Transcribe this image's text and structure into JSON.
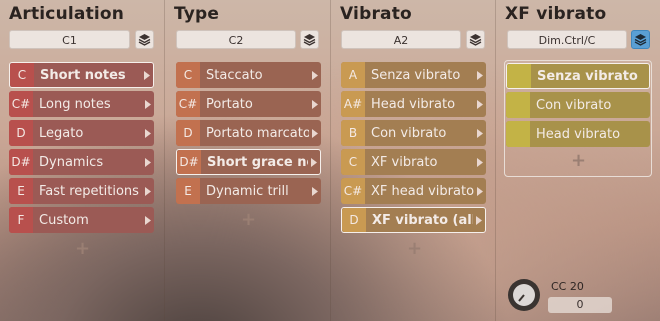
{
  "columns": [
    {
      "title": "Articulation",
      "field": "C1",
      "items": [
        {
          "key": "C",
          "label": "Short notes",
          "selected": true
        },
        {
          "key": "C#",
          "label": "Long notes"
        },
        {
          "key": "D",
          "label": "Legato"
        },
        {
          "key": "D#",
          "label": "Dynamics"
        },
        {
          "key": "E",
          "label": "Fast repetitions"
        },
        {
          "key": "F",
          "label": "Custom"
        }
      ],
      "add": "+"
    },
    {
      "title": "Type",
      "field": "C2",
      "items": [
        {
          "key": "C",
          "label": "Staccato"
        },
        {
          "key": "C#",
          "label": "Portato"
        },
        {
          "key": "D",
          "label": "Portato marcato"
        },
        {
          "key": "D#",
          "label": "Short grace note",
          "selected": true
        },
        {
          "key": "E",
          "label": "Dynamic trill"
        }
      ],
      "add": "+"
    },
    {
      "title": "Vibrato",
      "field": "A2",
      "items": [
        {
          "key": "A",
          "label": "Senza vibrato"
        },
        {
          "key": "A#",
          "label": "Head vibrato"
        },
        {
          "key": "B",
          "label": "Con vibrato"
        },
        {
          "key": "C",
          "label": "XF vibrato"
        },
        {
          "key": "C#",
          "label": "XF head vibrato"
        },
        {
          "key": "D",
          "label": "XF vibrato (all)",
          "selected": true
        }
      ],
      "add": "+"
    },
    {
      "title": "XF vibrato",
      "field": "Dim.Ctrl/C",
      "items": [
        {
          "key": "",
          "label": "Senza vibrato",
          "selected": true
        },
        {
          "key": "",
          "label": "Con vibrato"
        },
        {
          "key": "",
          "label": "Head vibrato"
        }
      ],
      "add": "+"
    }
  ],
  "cc": {
    "label": "CC 20",
    "value": "0"
  },
  "colors": {
    "articulation_item": "#9b5a55",
    "articulation_key": "#b8504d",
    "type_item": "#9a6452",
    "type_key": "#c2714f",
    "vibrato_item": "#a37e52",
    "vibrato_key": "#c99a52",
    "xf_item": "#a8924a",
    "xf_key": "#c3b346",
    "layers_active": "#5a9fd4"
  }
}
